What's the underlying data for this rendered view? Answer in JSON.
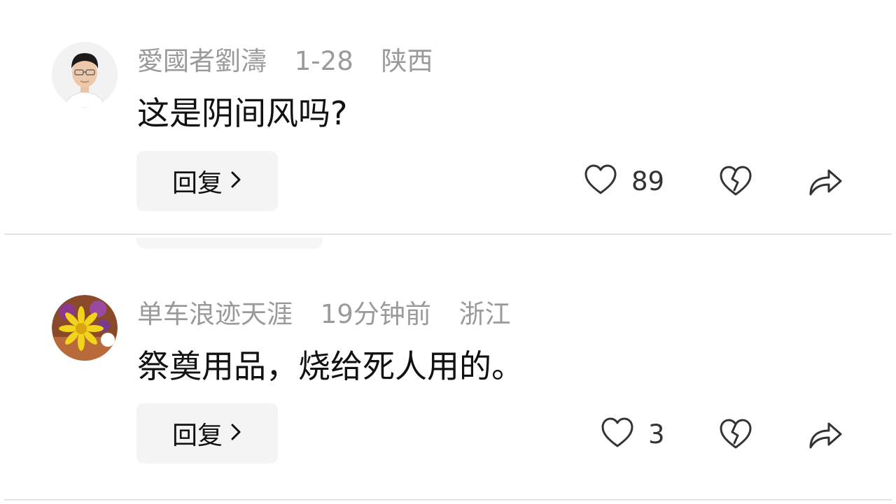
{
  "comments": [
    {
      "username": "愛國者劉濤",
      "time": "1-28",
      "location": "陕西",
      "content": "这是阴间风吗?",
      "reply_label": "回复",
      "likes": "89"
    },
    {
      "username": "单车浪迹天涯",
      "time": "19分钟前",
      "location": "浙江",
      "content": "祭奠用品，烧给死人用的。",
      "reply_label": "回复",
      "likes": "3"
    }
  ],
  "icons": {
    "like": "heart-outline-icon",
    "dislike": "broken-heart-icon",
    "share": "share-arrow-icon",
    "chevron": "chevron-right-icon"
  },
  "colors": {
    "meta_text": "#9a9a9a",
    "reply_bg": "#f4f4f4",
    "divider": "#e2e2e2"
  }
}
